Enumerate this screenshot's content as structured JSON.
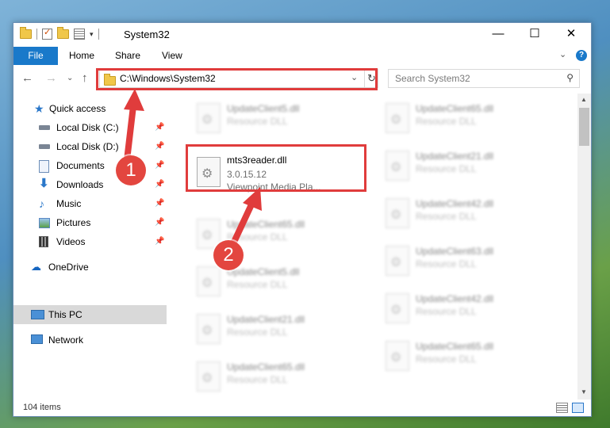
{
  "window": {
    "title": "System32",
    "controls": {
      "minimize": "—",
      "maximize": "☐",
      "close": "✕"
    }
  },
  "ribbon": {
    "file": "File",
    "tabs": [
      "Home",
      "Share",
      "View"
    ]
  },
  "address": {
    "path": "C:\\Windows\\System32",
    "search_placeholder": "Search System32"
  },
  "sidebar": {
    "items": [
      {
        "label": "Quick access",
        "icon": "star-icon",
        "pinned": false
      },
      {
        "label": "Local Disk (C:)",
        "icon": "drive-icon",
        "pinned": true
      },
      {
        "label": "Local Disk (D:)",
        "icon": "drive-icon",
        "pinned": true
      },
      {
        "label": "Documents",
        "icon": "documents-icon",
        "pinned": true
      },
      {
        "label": "Downloads",
        "icon": "download-icon",
        "pinned": true
      },
      {
        "label": "Music",
        "icon": "music-icon",
        "pinned": true
      },
      {
        "label": "Pictures",
        "icon": "pictures-icon",
        "pinned": true
      },
      {
        "label": "Videos",
        "icon": "videos-icon",
        "pinned": true
      },
      {
        "label": "OneDrive",
        "icon": "cloud-icon",
        "pinned": false
      },
      {
        "label": "This PC",
        "icon": "computer-icon",
        "pinned": false,
        "selected": true
      },
      {
        "label": "Network",
        "icon": "network-icon",
        "pinned": false
      }
    ]
  },
  "files": {
    "left": [
      {
        "name": "UpdateClient5.dll",
        "desc": "Resource DLL"
      },
      {
        "name": "UpdateClient65.dll",
        "desc": "Resource DLL"
      },
      {
        "name": "UpdateClient5.dll",
        "desc": "Resource DLL"
      },
      {
        "name": "UpdateClient21.dll",
        "desc": "Resource DLL"
      },
      {
        "name": "UpdateClient65.dll",
        "desc": "Resource DLL"
      }
    ],
    "right": [
      {
        "name": "UpdateClient65.dll",
        "desc": "Resource DLL"
      },
      {
        "name": "UpdateClient21.dll",
        "desc": "Resource DLL"
      },
      {
        "name": "UpdateClient42.dll",
        "desc": "Resource DLL"
      },
      {
        "name": "UpdateClient63.dll",
        "desc": "Resource DLL"
      },
      {
        "name": "UpdateClient42.dll",
        "desc": "Resource DLL"
      },
      {
        "name": "UpdateClient65.dll",
        "desc": "Resource DLL"
      }
    ],
    "selected": {
      "name": "mts3reader.dll",
      "version": "3.0.15.12",
      "desc": "Viewpoint Media Pla..."
    }
  },
  "status": {
    "count": "104 items"
  },
  "annotations": {
    "badge1": "1",
    "badge2": "2",
    "color": "#e03c3c"
  }
}
